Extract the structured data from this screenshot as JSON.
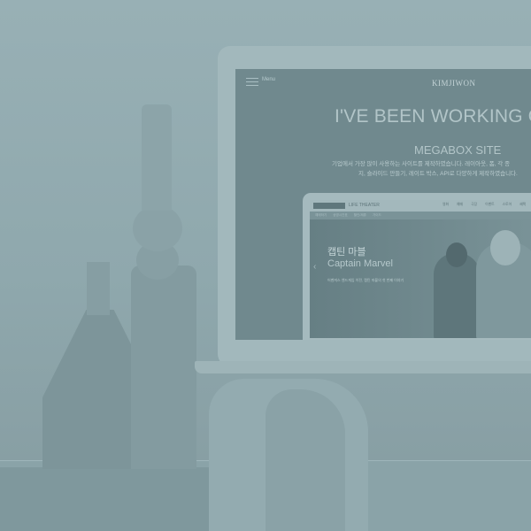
{
  "nav": {
    "menu_label": "Menu",
    "logo": "KIMJIWON"
  },
  "hero": {
    "title": "I'VE BEEN WORKING ON",
    "subtitle": "MEGABOX SITE",
    "description_line1": "기업에서 가장 많이 사용하는 사이트를 제작하였습니다. 레이아웃, 폼, 각 종",
    "description_line2": "지, 슬라이드 만들기, 레이트 박스, API로 다양하게 제작하였습니다."
  },
  "mockup": {
    "brand": "LIFE THEATER",
    "menu": "영화 예매 극장 이벤트 스토어 혜택",
    "subnav": "예매하기 상영시간표 할인/제휴 가이드",
    "movie_title_kr": "캡틴 마블",
    "movie_title_en": "Captain Marvel",
    "movie_desc": "어벤져스 엔드게임 이전, 캡틴 마블의 첫 번째 이야기"
  },
  "colors": {
    "tint": "#8fa8ad",
    "screen": "#70898e",
    "text_light": "#b2c5c8"
  }
}
